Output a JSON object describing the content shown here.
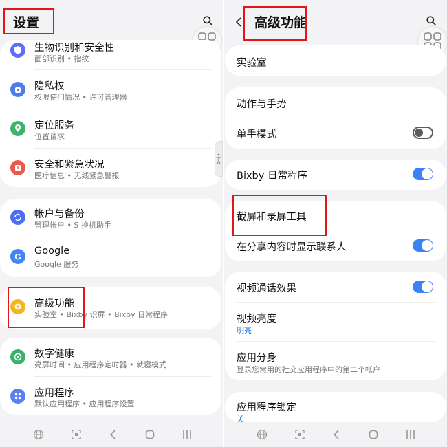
{
  "left": {
    "title": "设置",
    "items": [
      {
        "title": "生物识别和安全性",
        "subtitle": "面部识别 • 指纹",
        "icon": "shield-icon",
        "color": "#5c6ef5"
      },
      {
        "title": "隐私权",
        "subtitle": "权限使用情况 • 许可管理器",
        "icon": "privacy-icon",
        "color": "#4f7de8"
      },
      {
        "title": "定位服务",
        "subtitle": "位置请求",
        "icon": "location-pin-icon",
        "color": "#3db36b"
      },
      {
        "title": "安全和紧急状况",
        "subtitle": "医疗信息 • 无线紧急警报",
        "icon": "alert-icon",
        "color": "#e85a50"
      },
      {
        "title": "帐户与备份",
        "subtitle": "管理帐户 • S 换机助手",
        "icon": "sync-icon",
        "color": "#4c6ef0"
      },
      {
        "title": "Google",
        "subtitle": "Google 服务",
        "icon": "google-icon",
        "color": "#4285f4"
      },
      {
        "title": "高级功能",
        "subtitle": "实验室 • Bixby 识屏 • Bixby 日常程序",
        "icon": "gear-plus-icon",
        "color": "#f2b61f"
      },
      {
        "title": "数字健康",
        "subtitle": "亮屏时间 • 应用程序定时器 • 就寝模式",
        "icon": "heart-icon",
        "color": "#3bb26c"
      },
      {
        "title": "应用程序",
        "subtitle": "默认应用程序 • 应用程序设置",
        "icon": "apps-icon",
        "color": "#5a80f0"
      }
    ]
  },
  "right": {
    "title": "高级功能",
    "items": [
      {
        "title": "实验室"
      },
      {
        "title": "动作与手势"
      },
      {
        "title": "单手模式",
        "toggle": "off"
      },
      {
        "title": "Bixby 日常程序",
        "toggle": "on"
      },
      {
        "title": "截屏和录屏工具"
      },
      {
        "title": "在分享内容时显示联系人",
        "toggle": "on"
      },
      {
        "title": "视频通话效果",
        "toggle": "on"
      },
      {
        "title": "视频亮度",
        "subtitle": "明亮"
      },
      {
        "title": "应用分身",
        "subtitle": "登录您常用的社交应用程序中的第二个帐户"
      },
      {
        "title": "应用程序锁定",
        "subtitle": "关"
      }
    ]
  },
  "colors": {
    "accent": "#3b82f6",
    "highlight": "#e0161b",
    "link_blue": "#1a73e8"
  }
}
